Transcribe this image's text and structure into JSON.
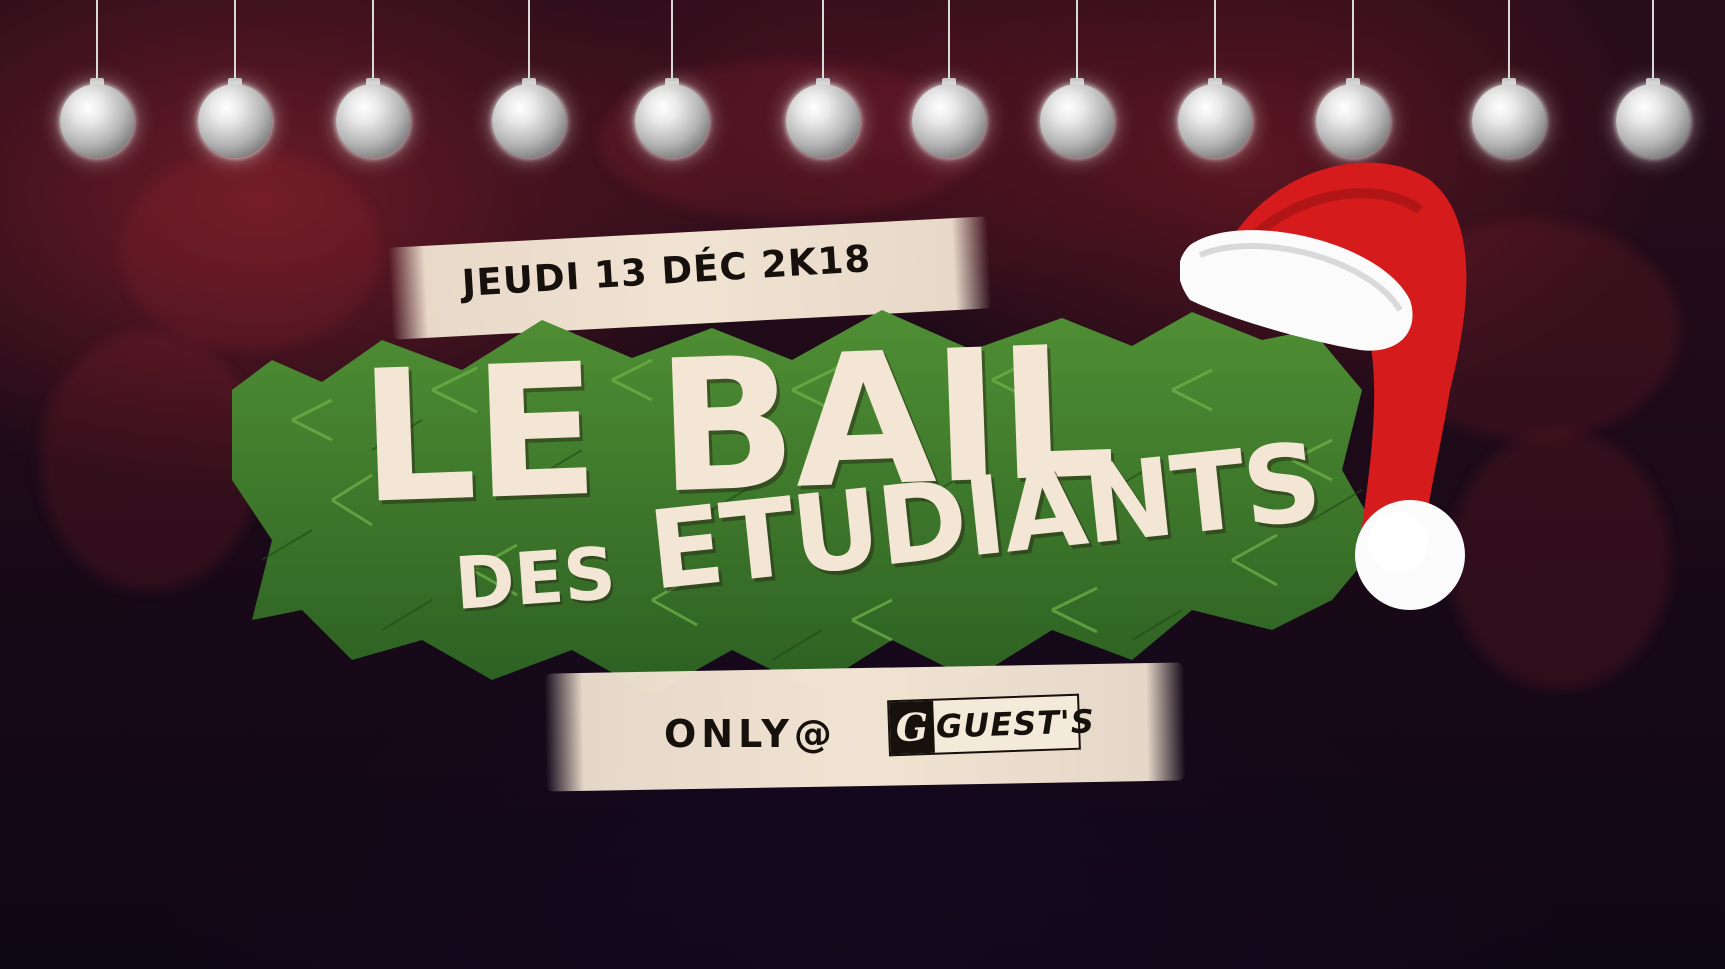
{
  "event": {
    "date": "JEUDI 13 DÉC 2K18",
    "title_line1": "LE BAIL",
    "title_des": "DES",
    "title_etudiants": "ETUDIANTS",
    "only_at": "ONLY@",
    "venue_logo": {
      "mark": "G",
      "text": "GUEST'S"
    }
  },
  "decorations": {
    "ornament_count": 12,
    "icons": [
      "ornament-icon",
      "santa-hat-icon",
      "pine-branches-icon"
    ]
  },
  "colors": {
    "cream": "#f3e6d4",
    "ink": "#17110d",
    "pine": "#3f7a2c",
    "hat_red": "#d51b1b",
    "background": "#1d0a18"
  }
}
